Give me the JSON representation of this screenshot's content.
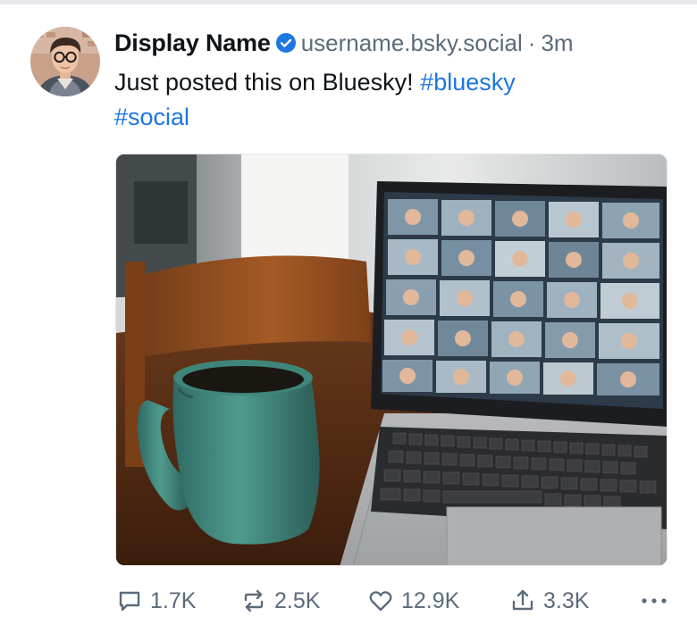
{
  "post": {
    "author": {
      "display_name": "Display Name",
      "handle": "username.bsky.social",
      "verified": true,
      "avatar_icon": "avatar-photo"
    },
    "separator": "·",
    "timestamp": "3m",
    "text": "Just posted this on Bluesky!",
    "hashtags": [
      "#bluesky",
      "#social"
    ],
    "image": {
      "alt_icon": "laptop-video-call-with-mug-photo"
    },
    "actions": {
      "reply": {
        "icon": "reply-icon",
        "count": "1.7K"
      },
      "repost": {
        "icon": "repost-icon",
        "count": "2.5K"
      },
      "like": {
        "icon": "heart-icon",
        "count": "12.9K"
      },
      "share": {
        "icon": "share-icon",
        "count": "3.3K"
      },
      "more": {
        "icon": "more-icon"
      }
    }
  },
  "colors": {
    "accent": "#1d76e2",
    "muted": "#5b6b7b",
    "text": "#0f1419"
  }
}
